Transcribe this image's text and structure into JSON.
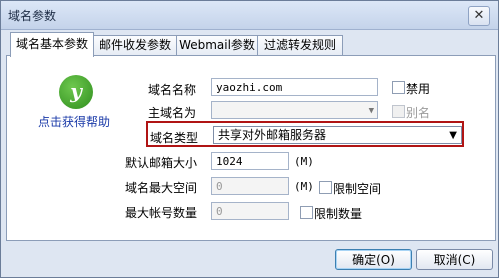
{
  "window": {
    "title": "域名参数",
    "close_glyph": "✕"
  },
  "tabs": [
    "域名基本参数",
    "邮件收发参数",
    "Webmail参数",
    "过滤转发规则"
  ],
  "help": {
    "link_text": "点击获得帮助",
    "logo_glyph": "y"
  },
  "form": {
    "domain_name_label": "域名名称",
    "domain_name_value": "yaozhi.com",
    "disable_label": "禁用",
    "primary_domain_label": "主域名为",
    "primary_domain_value": "",
    "alias_label": "别名",
    "domain_type_label": "域名类型",
    "domain_type_value": "共享对外邮箱服务器",
    "default_mailbox_label": "默认邮箱大小",
    "default_mailbox_value": "1024",
    "default_mailbox_unit": "(M)",
    "max_space_label": "域名最大空间",
    "max_space_value": "0",
    "max_space_unit": "(M)",
    "limit_space_label": "限制空间",
    "max_accounts_label": "最大帐号数量",
    "max_accounts_value": "0",
    "limit_count_label": "限制数量"
  },
  "buttons": {
    "ok": "确定(O)",
    "cancel": "取消(C)"
  }
}
